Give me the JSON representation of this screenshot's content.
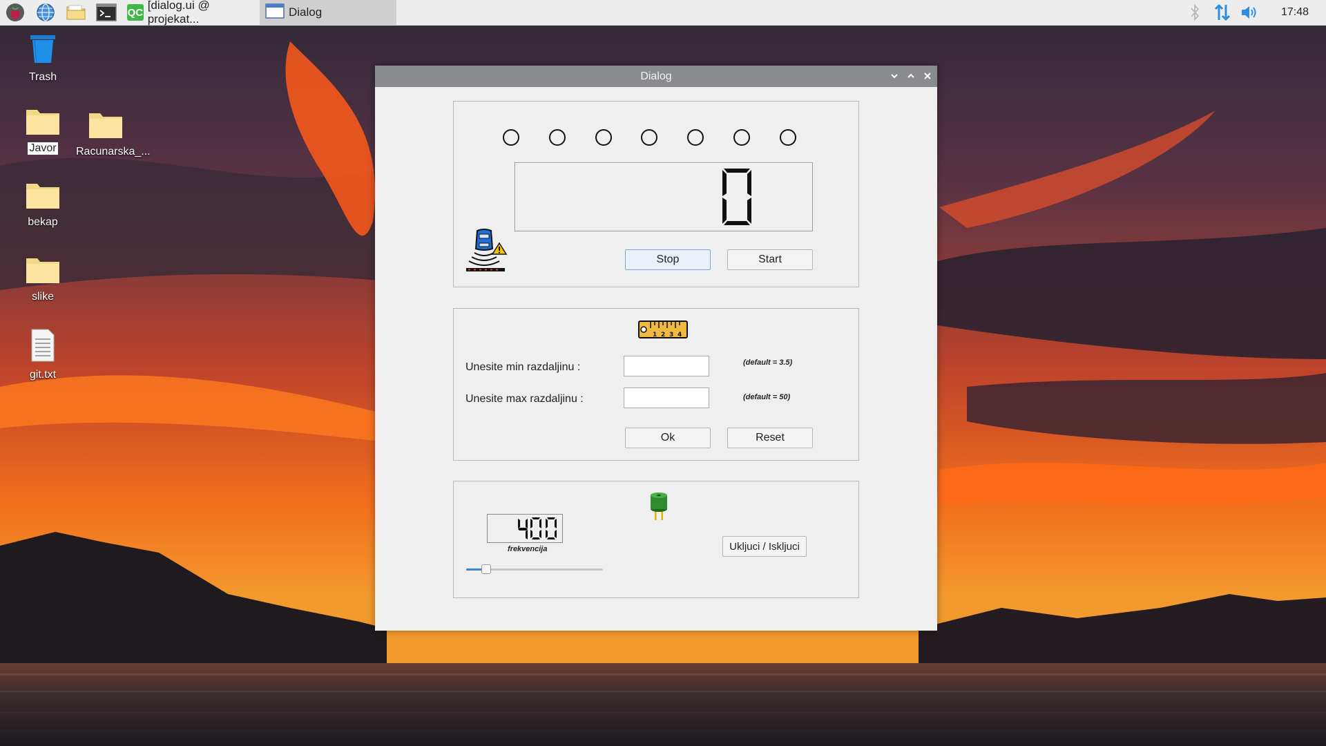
{
  "taskbar": {
    "launchers": [
      {
        "name": "raspberry-menu-icon"
      },
      {
        "name": "web-browser-icon"
      },
      {
        "name": "file-manager-icon"
      },
      {
        "name": "terminal-icon"
      }
    ],
    "tasks": [
      {
        "badge": "QC",
        "label": "[dialog.ui @ projekat..."
      },
      {
        "label": "Dialog"
      }
    ],
    "clock": "17:48"
  },
  "desktop": {
    "icons": [
      {
        "label": "Trash",
        "icon": "trash-icon"
      },
      {
        "label": "Javor",
        "icon": "folder-icon",
        "selected": true
      },
      {
        "label": "Racunarska_...",
        "icon": "folder-icon"
      },
      {
        "label": "bekap",
        "icon": "folder-icon"
      },
      {
        "label": "slike",
        "icon": "folder-icon"
      },
      {
        "label": "git.txt",
        "icon": "text-file-icon"
      }
    ]
  },
  "dialog": {
    "title": "Dialog",
    "sensor_panel": {
      "leds": 7,
      "lcd_value": "0",
      "icon": "parking-sensor-car-icon",
      "stop_label": "Stop",
      "start_label": "Start"
    },
    "distance_panel": {
      "icon": "measuring-tape-icon",
      "min_label": "Unesite min razdaljinu :",
      "max_label": "Unesite max razdaljinu :",
      "min_value": "",
      "max_value": "",
      "min_hint": "(default = 3.5)",
      "max_hint": "(default = 50)",
      "ok_label": "Ok",
      "reset_label": "Reset"
    },
    "buzzer_panel": {
      "lcd_value": "400",
      "lcd_label": "frekvencija",
      "slider_fraction": 0.12,
      "icon": "buzzer-icon",
      "toggle_label": "Ukljuci / Iskljuci"
    }
  },
  "colors": {
    "accent": "#3b86d6",
    "titlebar": "#898b8e",
    "qt_green": "#41b649"
  }
}
